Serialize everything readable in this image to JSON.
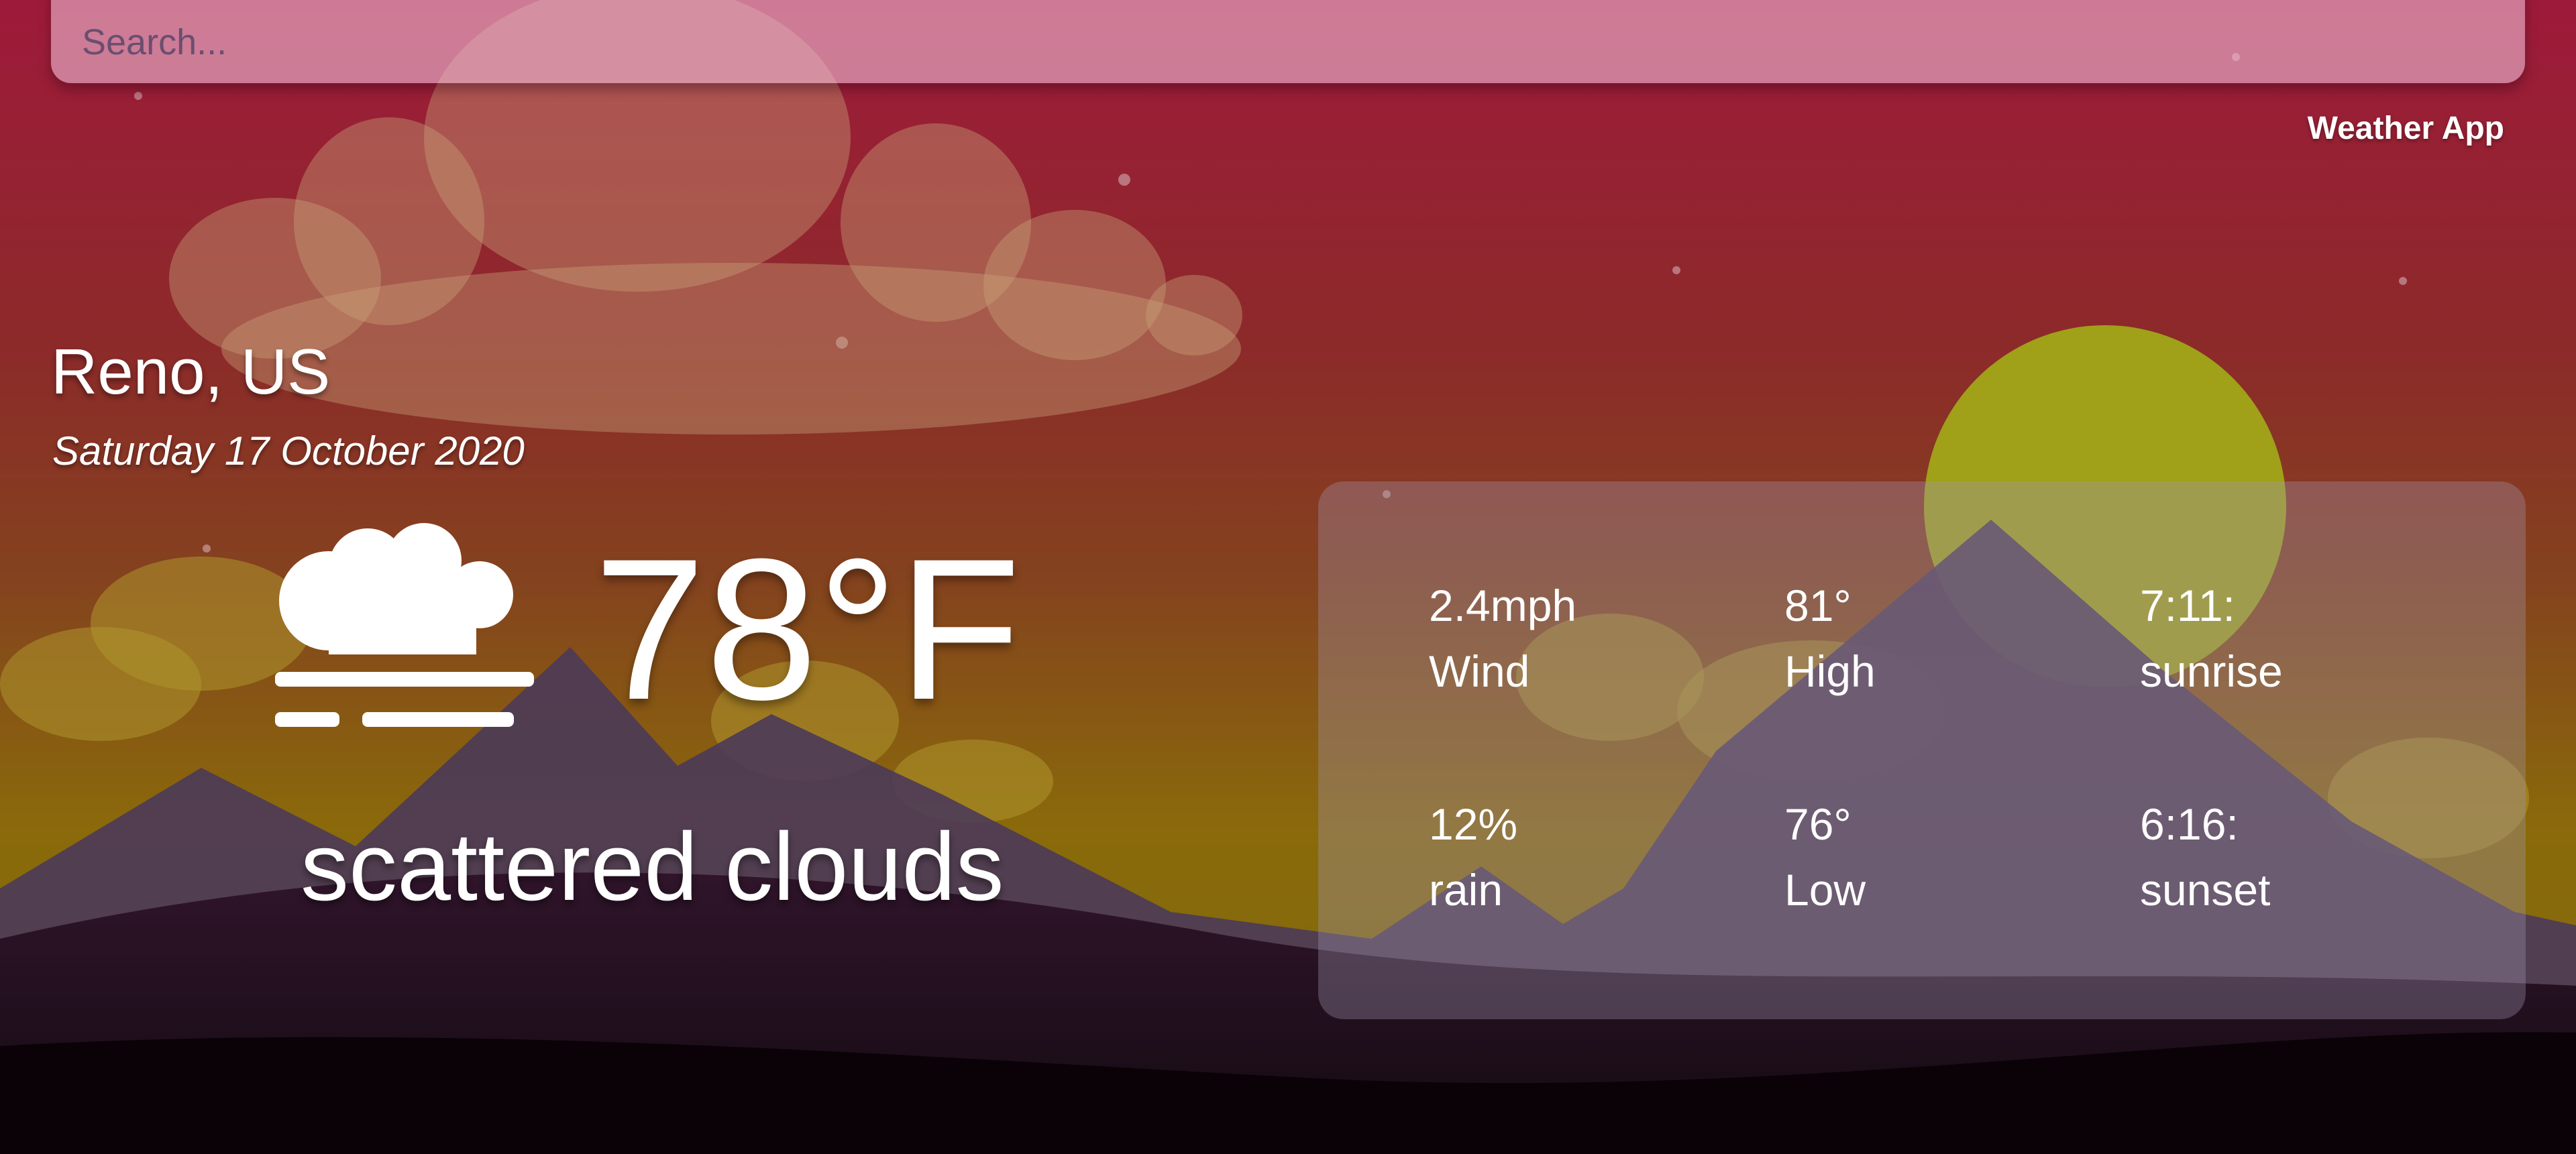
{
  "search": {
    "placeholder": "Search..."
  },
  "header": {
    "title": "Weather App"
  },
  "location": {
    "city": "Reno, US",
    "date": "Saturday 17 October 2020"
  },
  "current": {
    "icon": "cloud-fog-icon",
    "temperature": "78°F",
    "condition": "scattered clouds"
  },
  "stats": [
    {
      "value": "2.4mph",
      "label": "Wind"
    },
    {
      "value": "81°",
      "label": "High"
    },
    {
      "value": "7:11:",
      "label": "sunrise"
    },
    {
      "value": "12%",
      "label": "rain"
    },
    {
      "value": "76°",
      "label": "Low"
    },
    {
      "value": "6:16:",
      "label": "sunset"
    }
  ],
  "colors": {
    "sky_top": "#9e1a3a",
    "sky_mid": "#84421e",
    "sky_low": "#8a6a0a",
    "sun": "#a0a019",
    "mountain": "#4b3a58",
    "ground": "#0c0208"
  }
}
